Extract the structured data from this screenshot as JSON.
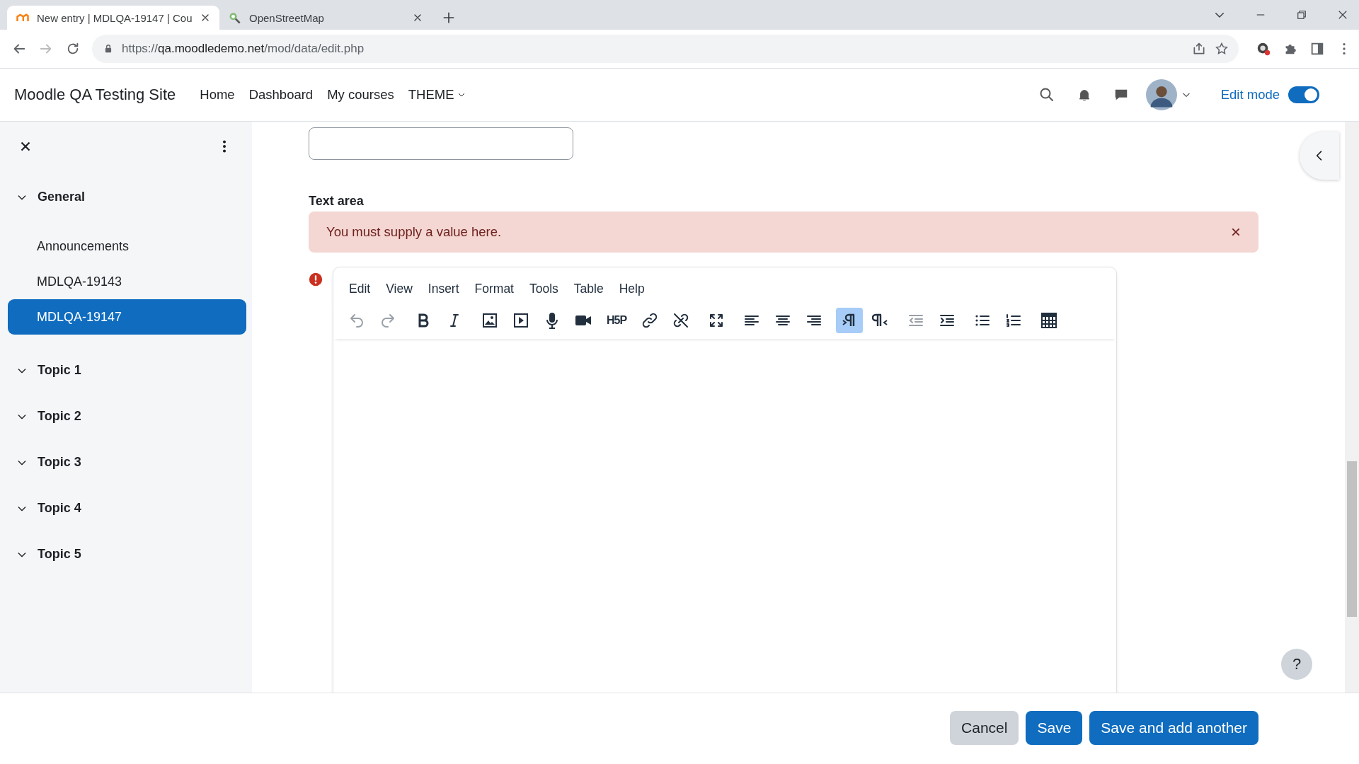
{
  "browser": {
    "tabs": [
      {
        "title": "New entry | MDLQA-19147 | Cou",
        "kind": "moodle",
        "selected": true
      },
      {
        "title": "OpenStreetMap",
        "kind": "map",
        "selected": false
      }
    ],
    "url_host": "qa.moodledemo.net",
    "url_prefix": "https://",
    "url_path": "/mod/data/edit.php"
  },
  "navbar": {
    "site_name": "Moodle QA Testing Site",
    "links": [
      {
        "label": "Home",
        "dropdown": false
      },
      {
        "label": "Dashboard",
        "dropdown": false
      },
      {
        "label": "My courses",
        "dropdown": false
      },
      {
        "label": "THEME",
        "dropdown": true
      }
    ],
    "edit_mode": {
      "label": "Edit mode",
      "on": true
    }
  },
  "sidebar": {
    "sections": [
      {
        "title": "General",
        "expanded": true,
        "items": [
          {
            "label": "Announcements",
            "selected": false
          },
          {
            "label": "MDLQA-19143",
            "selected": false
          },
          {
            "label": "MDLQA-19147",
            "selected": true
          }
        ]
      },
      {
        "title": "Topic 1",
        "expanded": true
      },
      {
        "title": "Topic 2",
        "expanded": true
      },
      {
        "title": "Topic 3",
        "expanded": true
      },
      {
        "title": "Topic 4",
        "expanded": true
      },
      {
        "title": "Topic 5",
        "expanded": true
      }
    ]
  },
  "form": {
    "text_area": {
      "label": "Text area",
      "error": "You must supply a value here.",
      "menu": [
        "Edit",
        "View",
        "Insert",
        "Format",
        "Tools",
        "Table",
        "Help"
      ],
      "toolbar": [
        [
          {
            "kind": "undo",
            "disabled": true,
            "selected": false
          },
          {
            "kind": "redo",
            "disabled": true,
            "selected": false
          }
        ],
        [
          {
            "kind": "bold",
            "disabled": false,
            "selected": false
          },
          {
            "kind": "italic",
            "disabled": false,
            "selected": false
          }
        ],
        [
          {
            "kind": "image",
            "disabled": false,
            "selected": false
          },
          {
            "kind": "media",
            "disabled": false,
            "selected": false
          },
          {
            "kind": "microphone",
            "disabled": false,
            "selected": false
          },
          {
            "kind": "video",
            "disabled": false,
            "selected": false
          },
          {
            "kind": "h5p",
            "text": "H5P",
            "disabled": false,
            "selected": false
          },
          {
            "kind": "link",
            "disabled": false,
            "selected": false
          },
          {
            "kind": "unlink",
            "disabled": false,
            "selected": false
          }
        ],
        [
          {
            "kind": "fullscreen",
            "disabled": false,
            "selected": false
          }
        ],
        [
          {
            "kind": "align-left",
            "disabled": false,
            "selected": false
          },
          {
            "kind": "align-center",
            "disabled": false,
            "selected": false
          },
          {
            "kind": "align-right",
            "disabled": false,
            "selected": false
          }
        ],
        [
          {
            "kind": "ltr",
            "disabled": false,
            "selected": true
          },
          {
            "kind": "rtl",
            "disabled": false,
            "selected": false
          }
        ],
        [
          {
            "kind": "outdent",
            "disabled": true,
            "selected": false
          },
          {
            "kind": "indent",
            "disabled": false,
            "selected": false
          }
        ],
        [
          {
            "kind": "bullet-list",
            "disabled": false,
            "selected": false
          },
          {
            "kind": "numbered-list",
            "disabled": false,
            "selected": false
          }
        ],
        [
          {
            "kind": "table",
            "disabled": false,
            "selected": false
          }
        ]
      ]
    }
  },
  "help_button": "?",
  "footer": {
    "buttons": [
      {
        "label": "Cancel",
        "kind": "secondary"
      },
      {
        "label": "Save",
        "kind": "primary"
      },
      {
        "label": "Save and add another",
        "kind": "primary"
      }
    ]
  }
}
